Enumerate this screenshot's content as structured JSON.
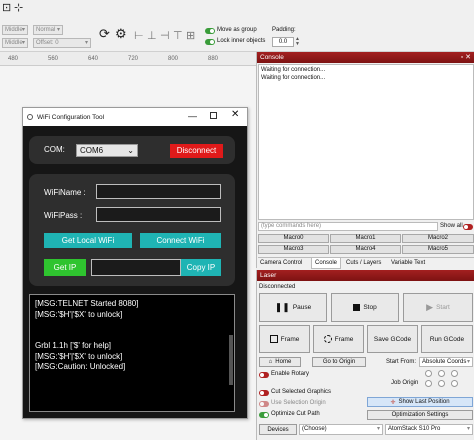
{
  "toolbar": {
    "sel1": "Middle",
    "sel2": "Normal",
    "sel3": "Middle",
    "offset": "Offset: 0",
    "move_as_group": "Move as group",
    "lock_inner": "Lock inner objects",
    "padding_label": "Padding:",
    "padding_value": "0.0"
  },
  "ruler": [
    "480",
    "560",
    "640",
    "720",
    "800",
    "880"
  ],
  "wifi": {
    "title": "WiFi Configuration Tool",
    "com_label": "COM:",
    "com_value": "COM6",
    "disconnect": "Disconnect",
    "wifi_name_label": "WiFiName :",
    "wifi_pass_label": "WiFiPass :",
    "get_local": "Get Local WiFi",
    "connect": "Connect WiFi",
    "get_ip": "Get IP",
    "copy_ip": "Copy IP",
    "console": [
      "[MSG:TELNET Started 8080]",
      "[MSG:'$H'|'$X' to unlock]",
      "",
      "",
      "Grbl 1.1h ['$' for help]",
      "[MSG:'$H'|'$X' to unlock]",
      "[MSG:Caution: Unlocked]"
    ]
  },
  "console_panel": {
    "title": "Console",
    "lines": [
      "Waiting for connection...",
      "Waiting for connection..."
    ],
    "cmd_placeholder": "(type commands here)",
    "show_all": "Show all",
    "macros": [
      "Macro0",
      "Macro1",
      "Macro2",
      "Macro3",
      "Macro4",
      "Macro5"
    ],
    "tabs": [
      "Camera Control",
      "Console",
      "Cuts / Layers",
      "Variable Text"
    ]
  },
  "laser": {
    "title": "Laser",
    "status": "Disconnected",
    "pause": "Pause",
    "stop": "Stop",
    "start": "Start",
    "frame1": "Frame",
    "frame2": "Frame",
    "save_gcode": "Save GCode",
    "run_gcode": "Run GCode",
    "home": "Home",
    "go_origin": "Go to Origin",
    "start_from_label": "Start From:",
    "start_from_value": "Absolute Coords",
    "job_origin": "Job Origin",
    "enable_rotary": "Enable Rotary",
    "cut_selected": "Cut Selected Graphics",
    "use_selection_origin": "Use Selection Origin",
    "optimize_cut": "Optimize Cut Path",
    "show_last": "Show Last Position",
    "opt_settings": "Optimization Settings",
    "devices": "Devices",
    "choose": "(Choose)",
    "device_model": "AtomStack S10 Pro"
  }
}
